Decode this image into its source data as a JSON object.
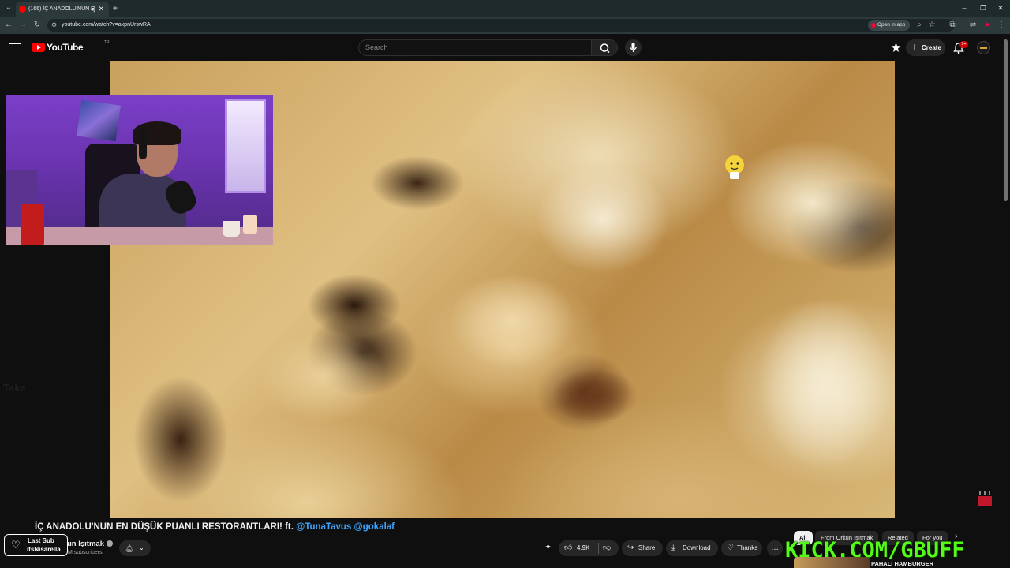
{
  "browser": {
    "tab_title": "(166) İÇ ANADOLU'NUN E",
    "url": "youtube.com/watch?v=axpnUrswRA",
    "open_in_app": "Open in app",
    "notif_count": "9+"
  },
  "header": {
    "logo_text": "YouTube",
    "logo_country": "TR",
    "search_placeholder": "Search",
    "create_label": "Create"
  },
  "video": {
    "title_text": "İÇ ANADOLU'NUN EN DÜŞÜK PUANLI RESTORANTLARI! ft.",
    "mentions": "@TunaTavus @gokalaf",
    "channel_name": "un Işıtmak",
    "subscribers": "M subscribers",
    "likes": "4.9K",
    "share": "Share",
    "download": "Download",
    "thanks": "Thanks",
    "overlay_ghost_text": "Take"
  },
  "chips": [
    "All",
    "From Orkun Işıtmak",
    "Related",
    "For you"
  ],
  "related": {
    "title": "PAHALI HAMBURGER"
  },
  "overlay": {
    "last_sub_label": "Last Sub",
    "last_sub_name": "itsNisarella",
    "kick_url": "KICK.COM/GBUFF"
  },
  "colors": {
    "accent": "#ff0000",
    "link": "#3ea6ff",
    "kick_green": "#53fc18"
  }
}
